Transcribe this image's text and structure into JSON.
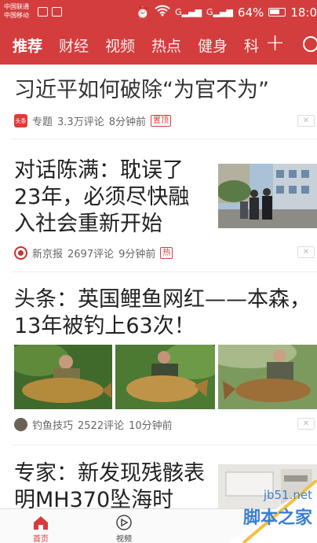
{
  "status_bar": {
    "carrier1": "中国联通",
    "carrier2": "中国移动",
    "sig1": "G",
    "sig2": "G",
    "battery": "64%",
    "time": "18:0"
  },
  "nav": {
    "tabs": [
      "推荐",
      "财经",
      "视频",
      "热点",
      "健身",
      "科"
    ],
    "plus": "+"
  },
  "articles": [
    {
      "title": "习近平如何破除“为官不为”",
      "source_logo": "头条",
      "source": "专题",
      "comments": "3.3万评论",
      "time": "8分钟前",
      "badge": "置顶",
      "dismiss": "✕"
    },
    {
      "title": "对话陈满：耽误了23年，必须尽快融入社会重新开始",
      "source": "新京报",
      "comments": "2697评论",
      "time": "9分钟前",
      "badge": "热",
      "dismiss": "✕"
    },
    {
      "title": "头条：英国鲤鱼网红——本森，13年被钓上63次！",
      "source": "钓鱼技巧",
      "comments": "2522评论",
      "time": "10分钟前",
      "dismiss": "✕"
    },
    {
      "title": "专家：新发现残骸表明MH370坠海时"
    }
  ],
  "bottom_nav": [
    {
      "label": "首页"
    },
    {
      "label": "视频"
    }
  ],
  "watermark": {
    "line1": "jb51.net",
    "line2": "脚本之家"
  },
  "colors": {
    "brand": "#d43d3d"
  }
}
